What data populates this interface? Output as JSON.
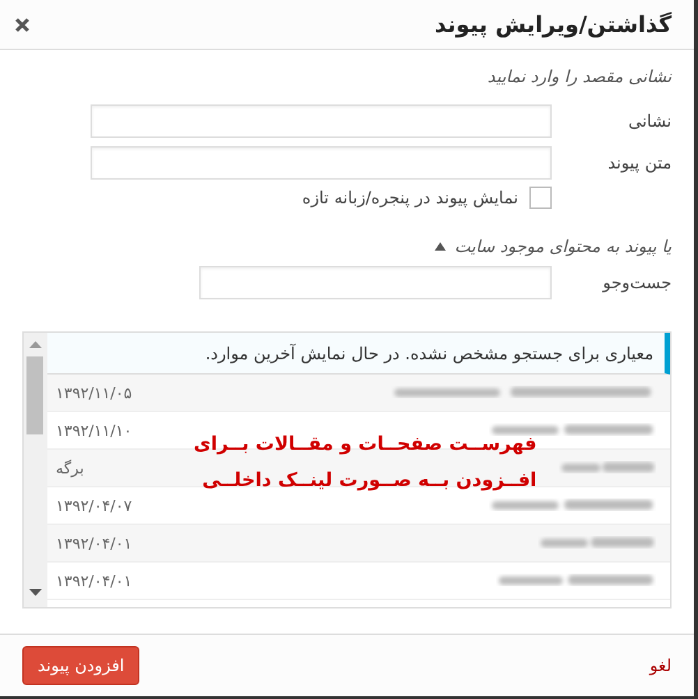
{
  "dialog": {
    "title": "گذاشتن/ویرایش پیوند"
  },
  "intro": "نشانی مقصد را وارد نمایید",
  "fields": [
    {
      "label": "نشانی"
    },
    {
      "label": "متن پیوند"
    }
  ],
  "new_tab": {
    "label": "نمایش پیوند در پنجره/زبانه تازه",
    "checked": false
  },
  "existing": {
    "label": "یا پیوند به محتوای موجود سایت",
    "expanded": true
  },
  "search": {
    "label": "جست‌وجو"
  },
  "notice": "معیاری برای جستجو مشخص نشده. در حال نمایش آخرین موارد.",
  "results": [
    {
      "info": "۱۳۹۲/۱۱/۰۵"
    },
    {
      "info": "۱۳۹۲/۱۱/۱۰"
    },
    {
      "info": "برگه"
    },
    {
      "info": "۱۳۹۲/۰۴/۰۷"
    },
    {
      "info": "۱۳۹۲/۰۴/۰۱"
    },
    {
      "info": "۱۳۹۲/۰۴/۰۱"
    }
  ],
  "annotation": [
    "فهرســت صفحــات و مقــالات بــرای",
    "افــزودن بــه صــورت لینــک داخلــی"
  ],
  "footer": {
    "cancel": "لغو",
    "submit": "افزودن پیوند"
  }
}
